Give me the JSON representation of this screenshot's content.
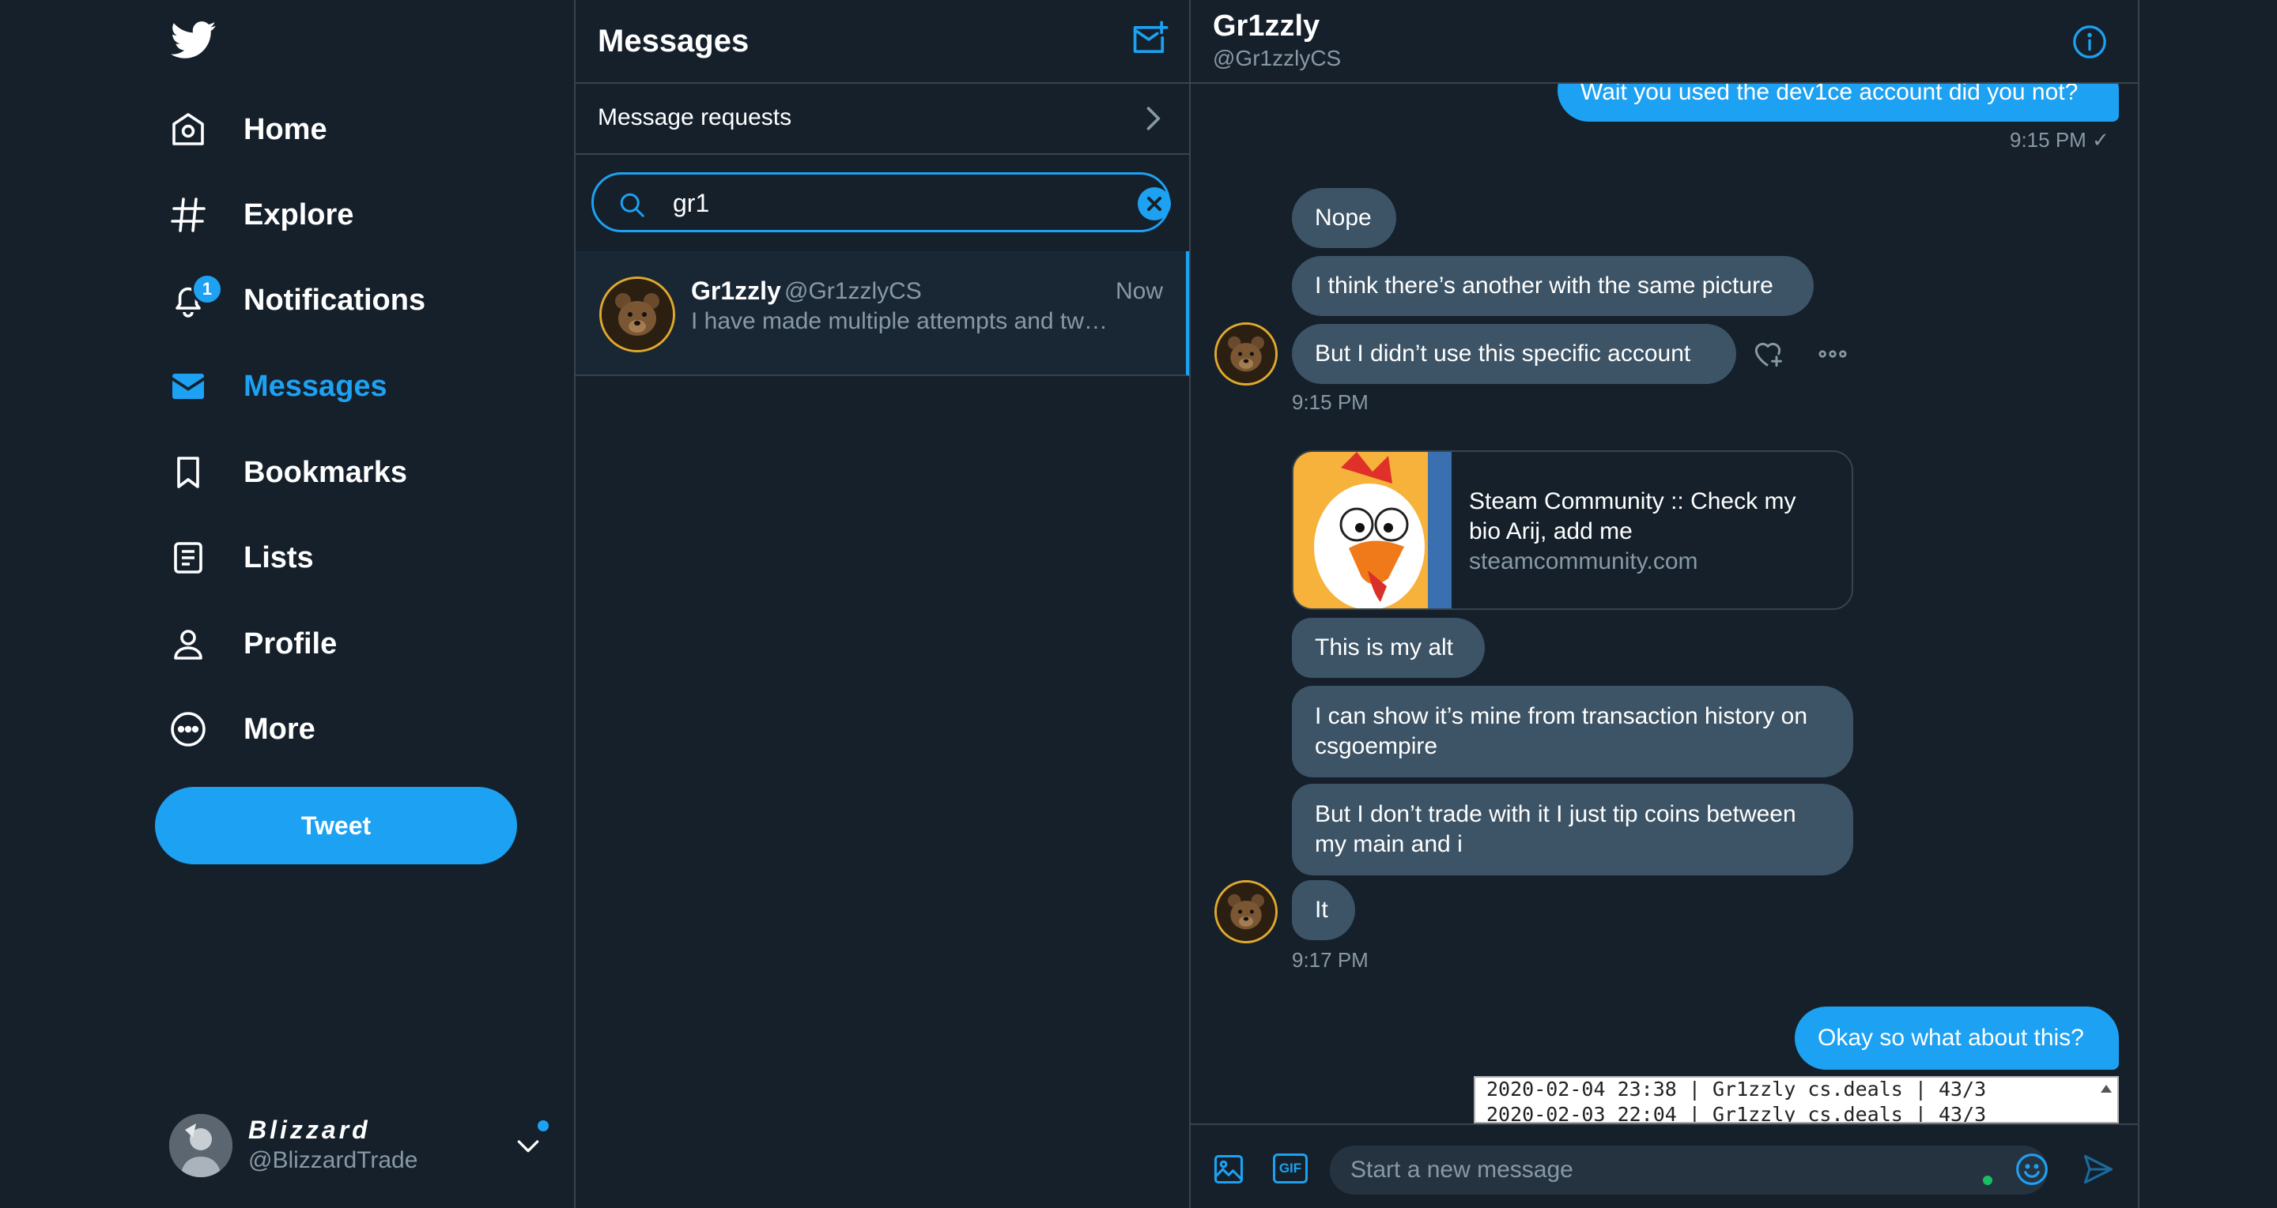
{
  "nav": {
    "items": [
      {
        "label": "Home",
        "icon": "home-icon"
      },
      {
        "label": "Explore",
        "icon": "hashtag-icon"
      },
      {
        "label": "Notifications",
        "icon": "bell-icon",
        "badge": "1"
      },
      {
        "label": "Messages",
        "icon": "envelope-icon",
        "active": true
      },
      {
        "label": "Bookmarks",
        "icon": "bookmark-icon"
      },
      {
        "label": "Lists",
        "icon": "list-icon"
      },
      {
        "label": "Profile",
        "icon": "person-icon"
      },
      {
        "label": "More",
        "icon": "more-circle-icon"
      }
    ],
    "tweet_label": "Tweet",
    "account": {
      "name": "Blizzard",
      "handle": "@BlizzardTrade"
    }
  },
  "list": {
    "title": "Messages",
    "requests_label": "Message requests",
    "search_value": "gr1",
    "conversation": {
      "name": "Gr1zzly",
      "handle": "@Gr1zzlyCS",
      "time": "Now",
      "preview": "I have made multiple attempts and tw…"
    }
  },
  "chat": {
    "name": "Gr1zzly",
    "handle": "@Gr1zzlyCS",
    "messages": {
      "out1": "Wait you used the dev1ce account did you not?",
      "out1_time": "9:15 PM ✓",
      "in1": "Nope",
      "in2": "I think there’s another with the same picture",
      "in3": "But I didn’t use this specific account",
      "in_time1": "9:15 PM",
      "card_title": "Steam Community :: Check my bio Arij, add me",
      "card_domain": "steamcommunity.com",
      "in4": "This is my alt",
      "in5": "I can show it’s mine from transaction history on csgoempire",
      "in6": "But I don’t trade with it I just tip coins between my main and i",
      "in7": "It",
      "in_time2": "9:17 PM",
      "out2": "Okay so what about this?",
      "attach_line1": "2020-02-04 23:38 | Gr1zzly cs.deals | 43/3",
      "attach_line2": "2020-02-03 22:04 | Gr1zzly cs.deals | 43/3"
    },
    "composer_placeholder": "Start a new message",
    "gif_label": "GIF"
  },
  "colors": {
    "background": "#15202b",
    "accent": "#1da1f2",
    "incoming_bubble": "#3d5466",
    "border": "#38444d",
    "muted": "#8899a6"
  }
}
